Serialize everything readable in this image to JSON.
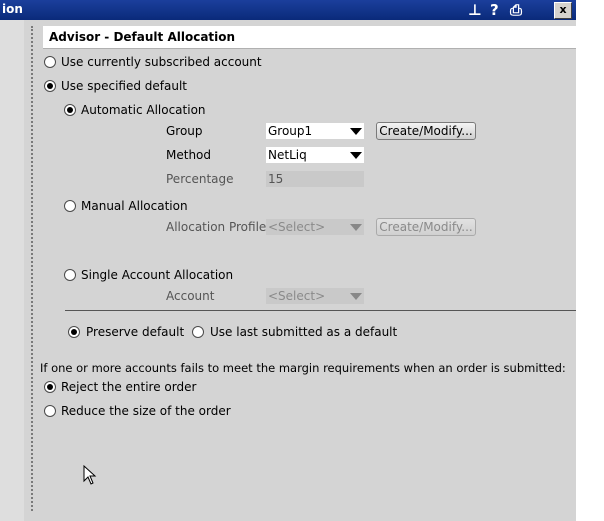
{
  "window": {
    "title_fragment": "ion",
    "close_label": "x",
    "icons": [
      "pin-icon",
      "help-icon",
      "print-icon",
      "close-icon"
    ],
    "help_glyph": "?",
    "pin_glyph": "⊥",
    "print_glyph": "⎙"
  },
  "header": {
    "title": "Advisor - Default Allocation"
  },
  "options": {
    "use_current": "Use currently subscribed account",
    "use_specified": "Use specified default"
  },
  "automatic": {
    "label": "Automatic Allocation",
    "group_label": "Group",
    "group_value": "Group1",
    "group_button": "Create/Modify...",
    "method_label": "Method",
    "method_value": "NetLiq",
    "percentage_label": "Percentage",
    "percentage_value": "15"
  },
  "manual": {
    "label": "Manual Allocation",
    "profile_label": "Allocation Profile",
    "profile_value": "<Select>",
    "profile_button": "Create/Modify..."
  },
  "single": {
    "label": "Single Account Allocation",
    "account_label": "Account",
    "account_value": "<Select>"
  },
  "default_mode": {
    "preserve": "Preserve default",
    "use_last": "Use last submitted as a default"
  },
  "margin": {
    "prompt": "If one or more accounts fails to meet the margin requirements when an order is submitted:",
    "reject": "Reject the entire order",
    "reduce": "Reduce the size of the order"
  },
  "colors": {
    "titlebar": "#0a2a7a",
    "panel": "#d4d4d4"
  }
}
